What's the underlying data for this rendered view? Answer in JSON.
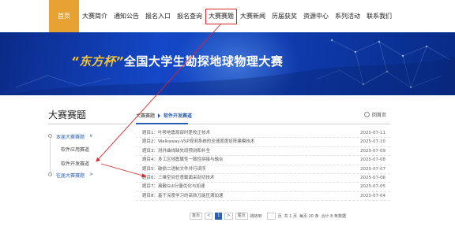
{
  "nav": {
    "items": [
      {
        "label": "首页"
      },
      {
        "label": "大赛简介"
      },
      {
        "label": "通知公告"
      },
      {
        "label": "报名入口"
      },
      {
        "label": "报名查询"
      },
      {
        "label": "大赛赛题"
      },
      {
        "label": "大赛新闻"
      },
      {
        "label": "历届获奖"
      },
      {
        "label": "资源中心"
      },
      {
        "label": "系列活动"
      },
      {
        "label": "联系我们"
      }
    ]
  },
  "banner": {
    "brand": "“东方杯”",
    "title": "全国大学生勘探地球物理大赛"
  },
  "sidebar": {
    "title": "大赛赛题",
    "items": [
      {
        "label": "本届大赛赛题",
        "chevron": "∨"
      },
      {
        "label": "软件应用赛道"
      },
      {
        "label": "软件开发赛道"
      },
      {
        "label": "往届大赛赛题",
        "chevron": ">"
      }
    ]
  },
  "breadcrumb": {
    "root": "大赛赛题",
    "current": "软件开发赛道"
  },
  "back_label": "回首页",
  "list": [
    {
      "title": "题目1：叶移地震局部时差校正技术",
      "date": "2025-07-11"
    },
    {
      "title": "题目2：Walkaway-VSP观测系统的全速度度矩阵建模技术",
      "date": "2025-07-10"
    },
    {
      "title": "题目3：测井曲线缺失段预测和补全",
      "date": "2025-07-09"
    },
    {
      "title": "题目4：多工区地震属性一致性拼接与融合",
      "date": "2025-07-08"
    },
    {
      "title": "题目5：破损二进制文件并行读序",
      "date": "2025-07-07"
    },
    {
      "title": "题目6：三维空间任意截面采剖切技术",
      "date": "2025-07-06"
    },
    {
      "title": "题目7：离散GUI分量优化与加速",
      "date": "2025-07-05"
    },
    {
      "title": "题目8：基于深度学习的高效万能压满加速",
      "date": "2025-07-04"
    }
  ],
  "pager": {
    "first": "首页",
    "prev": "<",
    "page": "1",
    "next": ">",
    "last": "尾页",
    "jump": "跳转到",
    "info_prefix": "页",
    "total_pages": "共 1 页",
    "per_page": "每页 20 条",
    "total_items": "合计 8 条数据"
  },
  "colors": {
    "nav_active": "#e7a233",
    "accent_blue": "#2a5fb0",
    "annotation_red": "#d9262b",
    "banner_brand": "#f5c436"
  }
}
